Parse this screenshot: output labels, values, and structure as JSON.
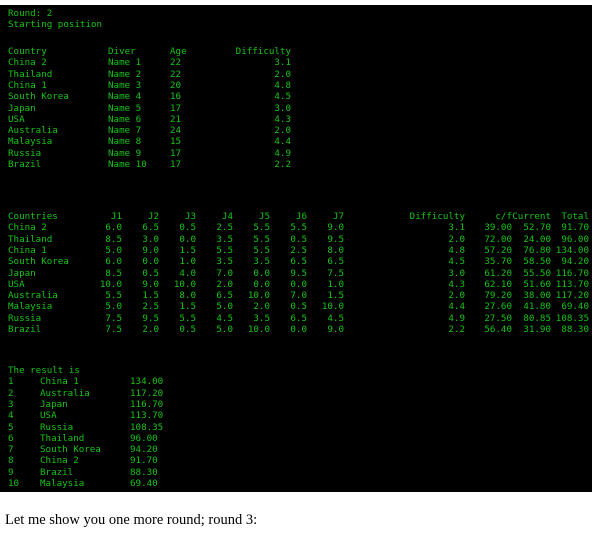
{
  "terminal": {
    "round_label": "Round: 2",
    "subtitle": "Starting position",
    "start_table": {
      "headers": [
        "Country",
        "Diver",
        "Age",
        "Difficulty"
      ],
      "rows": [
        {
          "country": "China 2",
          "diver": "Name 1",
          "age": "22",
          "difficulty": "3.1"
        },
        {
          "country": "Thailand",
          "diver": "Name 2",
          "age": "22",
          "difficulty": "2.0"
        },
        {
          "country": "China 1",
          "diver": "Name 3",
          "age": "20",
          "difficulty": "4.8"
        },
        {
          "country": "South Korea",
          "diver": "Name 4",
          "age": "16",
          "difficulty": "4.5"
        },
        {
          "country": "Japan",
          "diver": "Name 5",
          "age": "17",
          "difficulty": "3.0"
        },
        {
          "country": "USA",
          "diver": "Name 6",
          "age": "21",
          "difficulty": "4.3"
        },
        {
          "country": "Australia",
          "diver": "Name 7",
          "age": "24",
          "difficulty": "2.0"
        },
        {
          "country": "Malaysia",
          "diver": "Name 8",
          "age": "15",
          "difficulty": "4.4"
        },
        {
          "country": "Russia",
          "diver": "Name 9",
          "age": "17",
          "difficulty": "4.9"
        },
        {
          "country": "Brazil",
          "diver": "Name 10",
          "age": "17",
          "difficulty": "2.2"
        }
      ]
    },
    "scores_table": {
      "headers": [
        "Countries",
        "J1",
        "J2",
        "J3",
        "J4",
        "J5",
        "J6",
        "J7",
        "Difficulty",
        "c/f",
        "Current",
        "Total"
      ],
      "rows": [
        {
          "country": "China 2",
          "j": [
            "6.0",
            "6.5",
            "0.5",
            "2.5",
            "5.5",
            "5.5",
            "9.0"
          ],
          "difficulty": "3.1",
          "cf": "39.00",
          "current": "52.70",
          "total": "91.70"
        },
        {
          "country": "Thailand",
          "j": [
            "8.5",
            "3.0",
            "0.0",
            "3.5",
            "5.5",
            "0.5",
            "9.5"
          ],
          "difficulty": "2.0",
          "cf": "72.00",
          "current": "24.00",
          "total": "96.00"
        },
        {
          "country": "China 1",
          "j": [
            "5.0",
            "9.0",
            "1.5",
            "5.5",
            "5.5",
            "2.5",
            "8.0"
          ],
          "difficulty": "4.8",
          "cf": "57.20",
          "current": "76.80",
          "total": "134.00"
        },
        {
          "country": "South Korea",
          "j": [
            "6.0",
            "0.0",
            "1.0",
            "3.5",
            "3.5",
            "6.5",
            "6.5"
          ],
          "difficulty": "4.5",
          "cf": "35.70",
          "current": "58.50",
          "total": "94.20"
        },
        {
          "country": "Japan",
          "j": [
            "8.5",
            "0.5",
            "4.0",
            "7.0",
            "0.0",
            "9.5",
            "7.5"
          ],
          "difficulty": "3.0",
          "cf": "61.20",
          "current": "55.50",
          "total": "116.70"
        },
        {
          "country": "USA",
          "j": [
            "10.0",
            "9.0",
            "10.0",
            "2.0",
            "0.0",
            "0.0",
            "1.0"
          ],
          "difficulty": "4.3",
          "cf": "62.10",
          "current": "51.60",
          "total": "113.70"
        },
        {
          "country": "Australia",
          "j": [
            "5.5",
            "1.5",
            "8.0",
            "6.5",
            "10.0",
            "7.0",
            "1.5"
          ],
          "difficulty": "2.0",
          "cf": "79.20",
          "current": "38.00",
          "total": "117.20"
        },
        {
          "country": "Malaysia",
          "j": [
            "5.0",
            "2.5",
            "1.5",
            "5.0",
            "2.0",
            "0.5",
            "10.0"
          ],
          "difficulty": "4.4",
          "cf": "27.60",
          "current": "41.80",
          "total": "69.40"
        },
        {
          "country": "Russia",
          "j": [
            "7.5",
            "9.5",
            "5.5",
            "4.5",
            "3.5",
            "6.5",
            "4.5"
          ],
          "difficulty": "4.9",
          "cf": "27.50",
          "current": "80.85",
          "total": "108.35"
        },
        {
          "country": "Brazil",
          "j": [
            "7.5",
            "2.0",
            "0.5",
            "5.0",
            "10.0",
            "0.0",
            "9.0"
          ],
          "difficulty": "2.2",
          "cf": "56.40",
          "current": "31.90",
          "total": "88.30"
        }
      ]
    },
    "result_label": "The result is",
    "results": [
      {
        "rank": "1",
        "country": "China 1",
        "score": "134.00"
      },
      {
        "rank": "2",
        "country": "Australia",
        "score": "117.20"
      },
      {
        "rank": "3",
        "country": "Japan",
        "score": "116.70"
      },
      {
        "rank": "4",
        "country": "USA",
        "score": "113.70"
      },
      {
        "rank": "5",
        "country": "Russia",
        "score": "108.35"
      },
      {
        "rank": "6",
        "country": "Thailand",
        "score": "96.00"
      },
      {
        "rank": "7",
        "country": "South Korea",
        "score": "94.20"
      },
      {
        "rank": "8",
        "country": "China 2",
        "score": "91.70"
      },
      {
        "rank": "9",
        "country": "Brazil",
        "score": "88.30"
      },
      {
        "rank": "10",
        "country": "Malaysia",
        "score": "69.40"
      }
    ]
  },
  "caption": "Let me show you one more round; round 3:",
  "colors": {
    "terminal_background": "#000000",
    "terminal_text": "#16c416",
    "page_background": "#ffffff",
    "caption_text": "#000000"
  }
}
